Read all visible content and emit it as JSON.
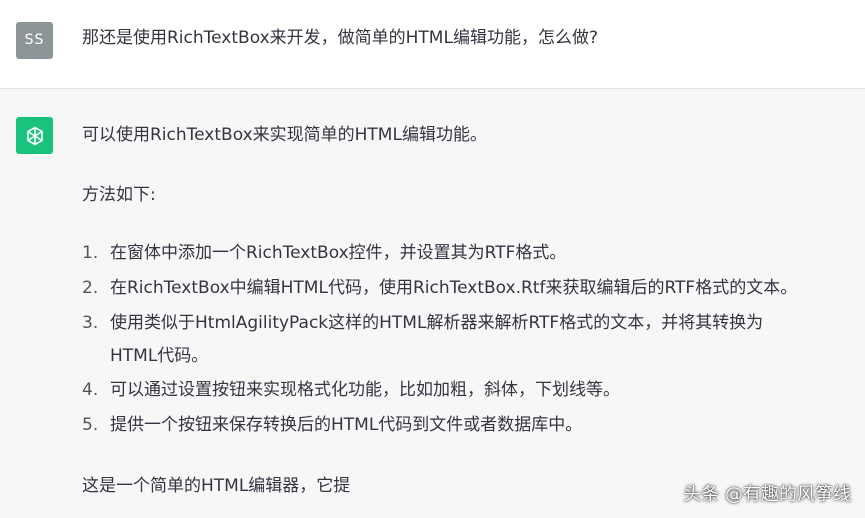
{
  "user": {
    "avatar_initials": "SS",
    "message": "那还是使用RichTextBox来开发，做简单的HTML编辑功能，怎么做?"
  },
  "assistant": {
    "icon": "openai-logo-icon",
    "intro": "可以使用RichTextBox来实现简单的HTML编辑功能。",
    "method_heading": "方法如下:",
    "steps": [
      {
        "num": "1.",
        "text": "在窗体中添加一个RichTextBox控件，并设置其为RTF格式。"
      },
      {
        "num": "2.",
        "text": "在RichTextBox中编辑HTML代码，使用RichTextBox.Rtf来获取编辑后的RTF格式的文本。"
      },
      {
        "num": "3.",
        "text": "使用类似于HtmlAgilityPack这样的HTML解析器来解析RTF格式的文本，并将其转换为",
        "text2": "HTML代码。"
      },
      {
        "num": "4.",
        "text": "可以通过设置按钮来实现格式化功能，比如加粗，斜体，下划线等。"
      },
      {
        "num": "5.",
        "text": "提供一个按钮来保存转换后的HTML代码到文件或者数据库中。"
      }
    ],
    "closing": "这是一个简单的HTML编辑器，它提"
  },
  "watermark": "头条 @有趣的风筝线",
  "colors": {
    "bot_avatar": "#19c37d",
    "user_avatar": "#8e9598",
    "bot_bg": "#f7f7f8",
    "user_bg": "#ffffff"
  }
}
